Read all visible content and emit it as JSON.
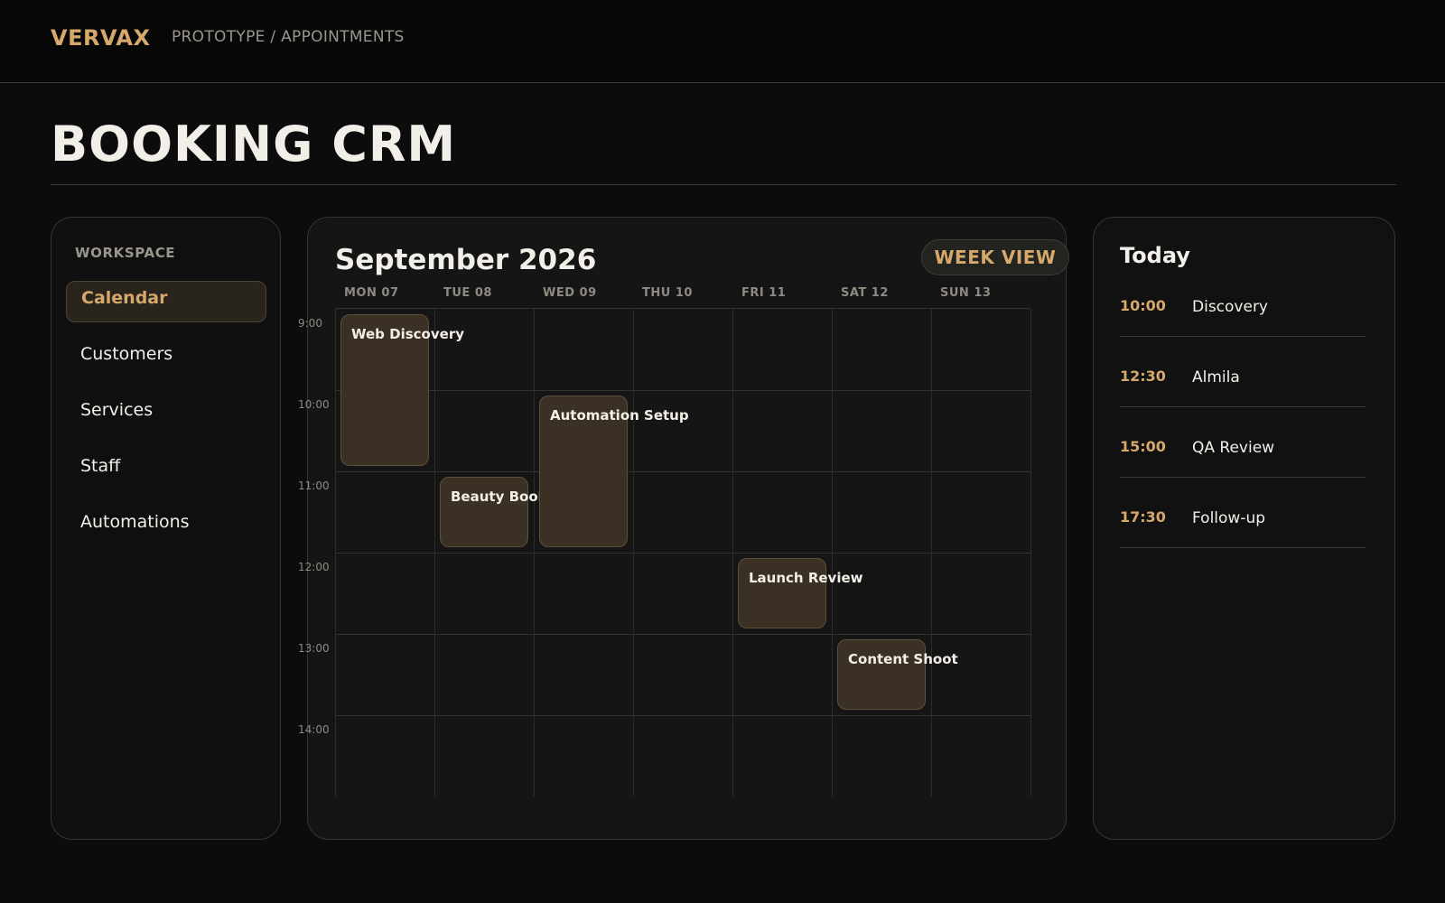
{
  "brand": "VERVAX",
  "breadcrumb": "PROTOTYPE / APPOINTMENTS",
  "page_title": "BOOKING CRM",
  "sidebar": {
    "section_label": "WORKSPACE",
    "items": [
      {
        "label": "Calendar",
        "active": true
      },
      {
        "label": "Customers",
        "active": false
      },
      {
        "label": "Services",
        "active": false
      },
      {
        "label": "Staff",
        "active": false
      },
      {
        "label": "Automations",
        "active": false
      }
    ]
  },
  "calendar": {
    "month_title": "September 2026",
    "view_button": "WEEK VIEW",
    "days": [
      "MON 07",
      "TUE 08",
      "WED 09",
      "THU 10",
      "FRI 11",
      "SAT 12",
      "SUN 13"
    ],
    "times": [
      "9:00",
      "10:00",
      "11:00",
      "12:00",
      "13:00",
      "14:00"
    ],
    "events": [
      {
        "title": "Web Discovery",
        "day": "MON 07",
        "start": "9:00",
        "end": "11:00"
      },
      {
        "title": "Beauty Book",
        "day": "TUE 08",
        "start": "11:00",
        "end": "12:00"
      },
      {
        "title": "Automation Setup",
        "day": "WED 09",
        "start": "10:00",
        "end": "12:00"
      },
      {
        "title": "Launch Review",
        "day": "FRI 11",
        "start": "12:00",
        "end": "13:00"
      },
      {
        "title": "Content Shoot",
        "day": "SAT 12",
        "start": "13:00",
        "end": "14:00"
      }
    ]
  },
  "today": {
    "title": "Today",
    "items": [
      {
        "time": "10:00",
        "name": "Discovery"
      },
      {
        "time": "12:30",
        "name": "Almila"
      },
      {
        "time": "15:00",
        "name": "QA Review"
      },
      {
        "time": "17:30",
        "name": "Follow-up"
      }
    ]
  },
  "colors": {
    "accent": "#d6a86b",
    "background": "#0c0c0c",
    "event_fill": "#3a3023"
  }
}
